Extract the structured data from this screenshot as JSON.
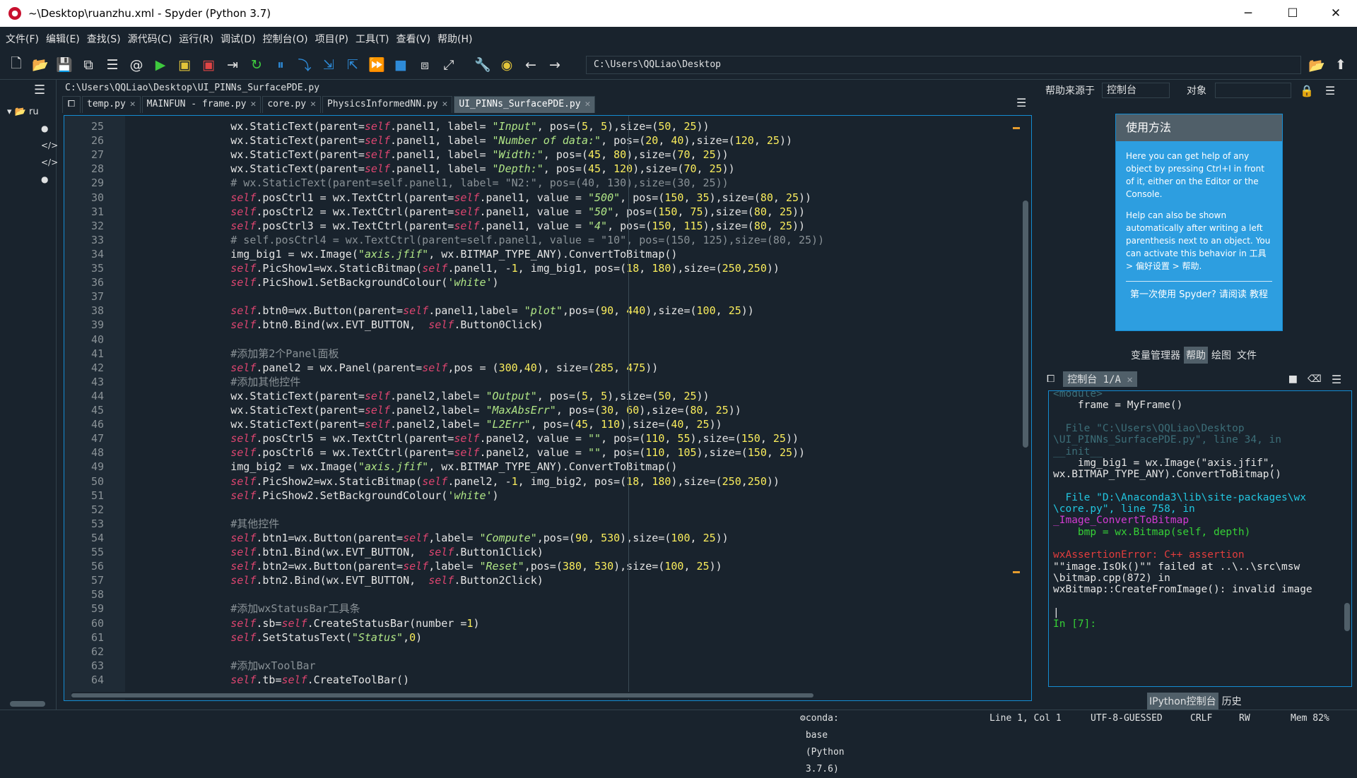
{
  "window": {
    "title": "~\\Desktop\\ruanzhu.xml - Spyder (Python 3.7)",
    "minimize": "─",
    "maximize": "☐",
    "close": "✕"
  },
  "menu": [
    "文件(F)",
    "编辑(E)",
    "查找(S)",
    "源代码(C)",
    "运行(R)",
    "调试(D)",
    "控制台(O)",
    "项目(P)",
    "工具(T)",
    "查看(V)",
    "帮助(H)"
  ],
  "toolbar": {
    "path": "C:\\Users\\QQLiao\\Desktop"
  },
  "filebrowser": {
    "root_label": "ru"
  },
  "editor": {
    "file_path": "C:\\Users\\QQLiao\\Desktop\\UI_PINNs_SurfacePDE.py",
    "tabs": [
      {
        "label": "temp.py",
        "active": false
      },
      {
        "label": "MAINFUN - frame.py",
        "active": false
      },
      {
        "label": "core.py",
        "active": false
      },
      {
        "label": "PhysicsInformedNN.py",
        "active": false
      },
      {
        "label": "UI_PINNs_SurfacePDE.py",
        "active": true
      }
    ],
    "lines": [
      {
        "n": "25",
        "t": "        wx.StaticText(parent=self.panel1, label= \"Input\", pos=(5, 5),size=(50, 25))"
      },
      {
        "n": "26",
        "t": "        wx.StaticText(parent=self.panel1, label= \"Number of data:\", pos=(20, 40),size=(120, 25))"
      },
      {
        "n": "27",
        "t": "        wx.StaticText(parent=self.panel1, label= \"Width:\", pos=(45, 80),size=(70, 25))"
      },
      {
        "n": "28",
        "t": "        wx.StaticText(parent=self.panel1, label= \"Depth:\", pos=(45, 120),size=(70, 25))"
      },
      {
        "n": "29",
        "t": "        # wx.StaticText(parent=self.panel1, label= \"N2:\", pos=(40, 130),size=(30, 25))"
      },
      {
        "n": "30",
        "t": "        self.posCtrl1 = wx.TextCtrl(parent=self.panel1, value = \"500\", pos=(150, 35),size=(80, 25))"
      },
      {
        "n": "31",
        "t": "        self.posCtrl2 = wx.TextCtrl(parent=self.panel1, value = \"50\", pos=(150, 75),size=(80, 25))"
      },
      {
        "n": "32",
        "t": "        self.posCtrl3 = wx.TextCtrl(parent=self.panel1, value = \"4\", pos=(150, 115),size=(80, 25))"
      },
      {
        "n": "33",
        "t": "        # self.posCtrl4 = wx.TextCtrl(parent=self.panel1, value = \"10\", pos=(150, 125),size=(80, 25))"
      },
      {
        "n": "34",
        "t": "        img_big1 = wx.Image(\"axis.jfif\", wx.BITMAP_TYPE_ANY).ConvertToBitmap()"
      },
      {
        "n": "35",
        "t": "        self.PicShow1=wx.StaticBitmap(self.panel1, -1, img_big1, pos=(18, 180),size=(250,250))"
      },
      {
        "n": "36",
        "t": "        self.PicShow1.SetBackgroundColour('white')"
      },
      {
        "n": "37",
        "t": ""
      },
      {
        "n": "38",
        "t": "        self.btn0=wx.Button(parent=self.panel1,label= \"plot\",pos=(90, 440),size=(100, 25))"
      },
      {
        "n": "39",
        "t": "        self.btn0.Bind(wx.EVT_BUTTON,  self.Button0Click)"
      },
      {
        "n": "40",
        "t": ""
      },
      {
        "n": "41",
        "t": "        #添加第2个Panel面板"
      },
      {
        "n": "42",
        "t": "        self.panel2 = wx.Panel(parent=self,pos = (300,40), size=(285, 475))"
      },
      {
        "n": "43",
        "t": "        #添加其他控件"
      },
      {
        "n": "44",
        "t": "        wx.StaticText(parent=self.panel2,label= \"Output\", pos=(5, 5),size=(50, 25))"
      },
      {
        "n": "45",
        "t": "        wx.StaticText(parent=self.panel2,label= \"MaxAbsErr\", pos=(30, 60),size=(80, 25))"
      },
      {
        "n": "46",
        "t": "        wx.StaticText(parent=self.panel2,label= \"L2Err\", pos=(45, 110),size=(40, 25))"
      },
      {
        "n": "47",
        "t": "        self.posCtrl5 = wx.TextCtrl(parent=self.panel2, value = \"\", pos=(110, 55),size=(150, 25))"
      },
      {
        "n": "48",
        "t": "        self.posCtrl6 = wx.TextCtrl(parent=self.panel2, value = \"\", pos=(110, 105),size=(150, 25))"
      },
      {
        "n": "49",
        "t": "        img_big2 = wx.Image(\"axis.jfif\", wx.BITMAP_TYPE_ANY).ConvertToBitmap()"
      },
      {
        "n": "50",
        "t": "        self.PicShow2=wx.StaticBitmap(self.panel2, -1, img_big2, pos=(18, 180),size=(250,250))"
      },
      {
        "n": "51",
        "t": "        self.PicShow2.SetBackgroundColour('white')"
      },
      {
        "n": "52",
        "t": ""
      },
      {
        "n": "53",
        "t": "        #其他控件"
      },
      {
        "n": "54",
        "t": "        self.btn1=wx.Button(parent=self,label= \"Compute\",pos=(90, 530),size=(100, 25))"
      },
      {
        "n": "55",
        "t": "        self.btn1.Bind(wx.EVT_BUTTON,  self.Button1Click)"
      },
      {
        "n": "56",
        "t": "        self.btn2=wx.Button(parent=self,label= \"Reset\",pos=(380, 530),size=(100, 25))"
      },
      {
        "n": "57",
        "t": "        self.btn2.Bind(wx.EVT_BUTTON,  self.Button2Click)"
      },
      {
        "n": "58",
        "t": ""
      },
      {
        "n": "59",
        "t": "        #添加wxStatusBar工具条"
      },
      {
        "n": "60",
        "t": "        self.sb=self.CreateStatusBar(number =1)"
      },
      {
        "n": "61",
        "t": "        self.SetStatusText(\"Status\",0)"
      },
      {
        "n": "62",
        "t": ""
      },
      {
        "n": "63",
        "t": "        #添加wxToolBar"
      },
      {
        "n": "64",
        "t": "        self.tb=self.CreateToolBar()"
      }
    ]
  },
  "help": {
    "source_label": "帮助来源于",
    "source_value": "控制台",
    "object_label": "对象",
    "card_title": "使用方法",
    "card_p1": "Here you can get help of any object by pressing Ctrl+I in front of it, either on the Editor or the Console.",
    "card_p2": "Help can also be shown automatically after writing a left parenthesis next to an object. You can activate this behavior in 工具 > 偏好设置 > 帮助.",
    "card_footer": "第一次使用 Spyder? 请阅读 教程",
    "tabs": [
      "变量管理器",
      "帮助",
      "绘图",
      "文件"
    ]
  },
  "console": {
    "tab_label": "控制台 1/A",
    "lines": [
      {
        "t": "<module>",
        "c": "dim"
      },
      {
        "t": "    frame = MyFrame()",
        "c": ""
      },
      {
        "t": "",
        "c": ""
      },
      {
        "t": "  File \"C:\\Users\\QQLiao\\Desktop",
        "c": "dim"
      },
      {
        "t": "\\UI_PINNs_SurfacePDE.py\", line 34, in",
        "c": "dim"
      },
      {
        "t": "__init__",
        "c": "dim"
      },
      {
        "t": "    img_big1 = wx.Image(\"axis.jfif\",",
        "c": ""
      },
      {
        "t": "wx.BITMAP_TYPE_ANY).ConvertToBitmap()",
        "c": ""
      },
      {
        "t": "",
        "c": ""
      },
      {
        "t": "  File \"D:\\Anaconda3\\lib\\site-packages\\wx",
        "c": "cyan"
      },
      {
        "t": "\\core.py\", line 758, in",
        "c": "cyan"
      },
      {
        "t": "_Image_ConvertToBitmap",
        "c": "mag"
      },
      {
        "t": "    bmp = wx.Bitmap(self, depth)",
        "c": "grn"
      },
      {
        "t": "",
        "c": ""
      },
      {
        "t": "wxAssertionError: C++ assertion",
        "c": "red"
      },
      {
        "t": "\"\"image.IsOk()\"\" failed at ..\\..\\src\\msw",
        "c": ""
      },
      {
        "t": "\\bitmap.cpp(872) in",
        "c": ""
      },
      {
        "t": "wxBitmap::CreateFromImage(): invalid image",
        "c": ""
      },
      {
        "t": "",
        "c": ""
      },
      {
        "t": "|",
        "c": ""
      },
      {
        "t": "In [7]:",
        "c": "grn"
      }
    ],
    "bottom_tabs": [
      "IPython控制台",
      "历史"
    ]
  },
  "status": {
    "conda": "conda: base (Python 3.7.6)",
    "position": "Line 1, Col 1",
    "encoding": "UTF-8-GUESSED",
    "eol": "CRLF",
    "rw": "RW",
    "mem": "Mem 82%"
  }
}
